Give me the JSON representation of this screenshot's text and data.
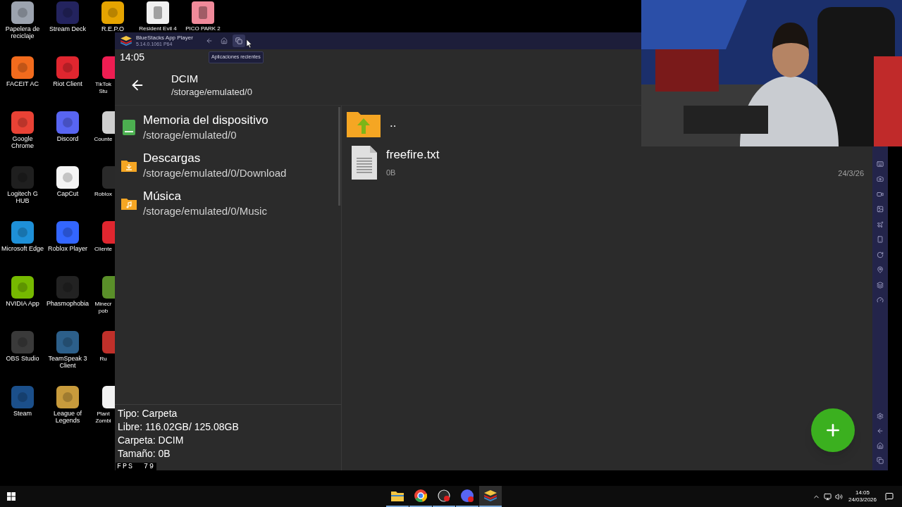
{
  "desktop": {
    "columns": [
      [
        {
          "label": "Papelera de reciclaje",
          "color": "#9ca3af"
        },
        {
          "label": "FACEIT AC",
          "color": "#f26b1d"
        },
        {
          "label": "Google Chrome",
          "color": "#e94235"
        },
        {
          "label": "Logitech G HUB",
          "color": "#1f1f1f"
        },
        {
          "label": "Microsoft Edge",
          "color": "#1e90d8"
        },
        {
          "label": "NVIDIA App",
          "color": "#76b900"
        },
        {
          "label": "OBS Studio",
          "color": "#3a3a3a"
        },
        {
          "label": "Steam",
          "color": "#1b4f8a"
        }
      ],
      [
        {
          "label": "Stream Deck",
          "color": "#23235e"
        },
        {
          "label": "Riot Client",
          "color": "#e0262f"
        },
        {
          "label": "Discord",
          "color": "#5865f2"
        },
        {
          "label": "CapCut",
          "color": "#f5f5f5"
        },
        {
          "label": "Roblox Player",
          "color": "#3366ff"
        },
        {
          "label": "Phasmophobia",
          "color": "#222222"
        },
        {
          "label": "TeamSpeak 3 Client",
          "color": "#2c5f8a"
        },
        {
          "label": "League of Legends",
          "color": "#c89b3c"
        }
      ],
      [
        {
          "label": "R.E.P.O",
          "color": "#e6a400"
        },
        {
          "label": "TikTok Stu",
          "color": "#ee1d52"
        },
        {
          "label": "Counte",
          "color": "#cfcfcf"
        },
        {
          "label": "Roblox",
          "color": "#2a2a2a"
        },
        {
          "label": "Cliente",
          "color": "#e0262f"
        },
        {
          "label": "Minecr pob",
          "color": "#5a8f29"
        },
        {
          "label": "Ru",
          "color": "#c0302a"
        },
        {
          "label": "Plant Zombi",
          "color": "#f2f2f2"
        }
      ]
    ],
    "top_row": [
      {
        "label": "Resident Evil 4",
        "color": "#f0f0f0"
      },
      {
        "label": "PICO PARK 2",
        "color": "#f08a9a"
      }
    ]
  },
  "window": {
    "title": "BlueStacks App Player",
    "version": "5.14.0.1061 P64",
    "tooltip": "Aplicaciones recientes"
  },
  "android": {
    "time": "14:05",
    "header": {
      "title": "DCIM",
      "path": "/storage/emulated/0"
    },
    "locations": [
      {
        "kind": "device",
        "name": "Memoria del dispositivo",
        "path": "/storage/emulated/0"
      },
      {
        "kind": "download",
        "name": "Descargas",
        "path": "/storage/emulated/0/Download"
      },
      {
        "kind": "music",
        "name": "Música",
        "path": "/storage/emulated/0/Music"
      }
    ],
    "info": [
      "Tipo: Carpeta",
      "Libre: 116.02GB/ 125.08GB",
      "Carpeta: DCIM",
      "Tamaño: 0B"
    ],
    "files": [
      {
        "kind": "parent",
        "name": ".."
      },
      {
        "kind": "file",
        "name": "freefire.txt",
        "size": "0B",
        "date": "24/3/26"
      }
    ]
  },
  "fps": {
    "label": "FPS",
    "value": "79"
  },
  "taskbar": {
    "apps": [
      {
        "kind": "folder",
        "selected": false
      },
      {
        "kind": "browser",
        "selected": false
      },
      {
        "kind": "recorder",
        "selected": false
      },
      {
        "kind": "chat",
        "selected": false
      },
      {
        "kind": "emulator",
        "selected": true
      }
    ],
    "time": "14:05",
    "date": "24/03/2026"
  }
}
